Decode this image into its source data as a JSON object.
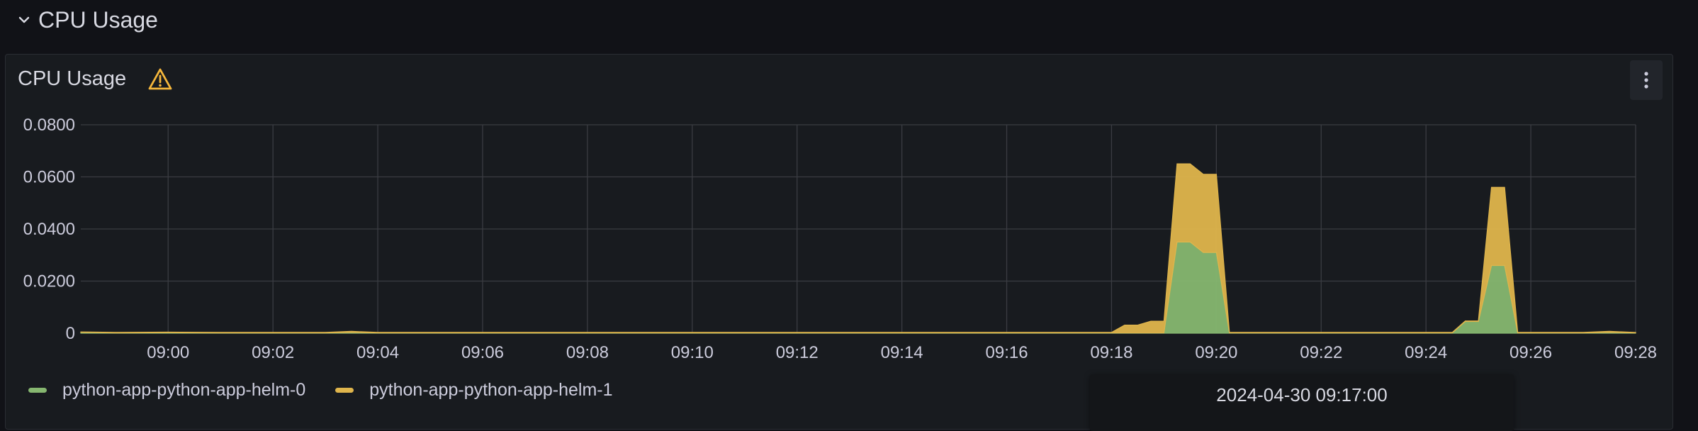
{
  "row": {
    "title": "CPU Usage",
    "icon": "chevron-down-icon"
  },
  "panel": {
    "title": "CPU Usage",
    "warning_icon": "warning-icon",
    "menu_icon": "vertical-ellipsis-icon"
  },
  "tooltip": {
    "time": "2024-04-30 09:17:00"
  },
  "colors": {
    "helm0": "#86b770",
    "helm1": "#dfb54c",
    "grid": "#3a3c42",
    "axis_text": "#ccccdc"
  },
  "chart_data": {
    "type": "area",
    "stacked": true,
    "x_ticks": [
      "09:00",
      "09:02",
      "09:04",
      "09:06",
      "09:08",
      "09:10",
      "09:12",
      "09:14",
      "09:16",
      "09:18",
      "09:20",
      "09:22",
      "09:24",
      "09:26",
      "09:28"
    ],
    "y_ticks": [
      "0",
      "0.0200",
      "0.0400",
      "0.0600",
      "0.0800"
    ],
    "ylim": [
      0,
      0.08
    ],
    "xlim": [
      "08:58:20",
      "09:28:00"
    ],
    "x": [
      "08:58:20",
      "08:59:00",
      "09:00:00",
      "09:01:00",
      "09:02:00",
      "09:03:00",
      "09:03:30",
      "09:04:00",
      "09:05:00",
      "09:06:00",
      "09:07:00",
      "09:08:00",
      "09:09:00",
      "09:10:00",
      "09:11:00",
      "09:12:00",
      "09:13:00",
      "09:14:00",
      "09:15:00",
      "09:16:00",
      "09:17:00",
      "09:18:00",
      "09:18:15",
      "09:18:30",
      "09:18:45",
      "09:19:00",
      "09:19:15",
      "09:19:30",
      "09:19:45",
      "09:20:00",
      "09:20:15",
      "09:20:30",
      "09:21:00",
      "09:22:00",
      "09:23:00",
      "09:24:00",
      "09:24:15",
      "09:24:30",
      "09:24:45",
      "09:25:00",
      "09:25:15",
      "09:25:30",
      "09:25:45",
      "09:26:00",
      "09:27:00",
      "09:27:30",
      "09:28:00"
    ],
    "series": [
      {
        "name": "python-app-python-app-helm-0",
        "color": "#86b770",
        "values": [
          0.0003,
          0.0001,
          0.0002,
          0.0001,
          0.0001,
          0.0001,
          0.0003,
          0.0001,
          0.0001,
          0.0001,
          0.0001,
          0.0001,
          0.0001,
          0.0001,
          0.0001,
          0.0001,
          0.0001,
          0.0001,
          0.0001,
          0.0001,
          0.0001,
          0.0001,
          0.0001,
          0.0001,
          0.0001,
          0.0001,
          0.035,
          0.035,
          0.031,
          0.031,
          0.0001,
          0.0001,
          0.0001,
          0.0001,
          0.0001,
          0.0001,
          0.0001,
          0.0001,
          0.0045,
          0.0045,
          0.026,
          0.026,
          0.0001,
          0.0001,
          0.0001,
          0.0003,
          0.0001
        ]
      },
      {
        "name": "python-app-python-app-helm-1",
        "color": "#dfb54c",
        "values": [
          0.0002,
          0.0002,
          0.0002,
          0.0002,
          0.0002,
          0.0002,
          0.0004,
          0.0002,
          0.0002,
          0.0002,
          0.0002,
          0.0002,
          0.0002,
          0.0002,
          0.0002,
          0.0002,
          0.0002,
          0.0002,
          0.0002,
          0.0002,
          0.0002,
          0.0002,
          0.003,
          0.003,
          0.0045,
          0.0045,
          0.03,
          0.03,
          0.03,
          0.03,
          0.0002,
          0.0002,
          0.0002,
          0.0002,
          0.0002,
          0.0002,
          0.0002,
          0.0002,
          0.0002,
          0.0002,
          0.03,
          0.03,
          0.0002,
          0.0002,
          0.0002,
          0.0004,
          0.0002
        ]
      }
    ]
  }
}
